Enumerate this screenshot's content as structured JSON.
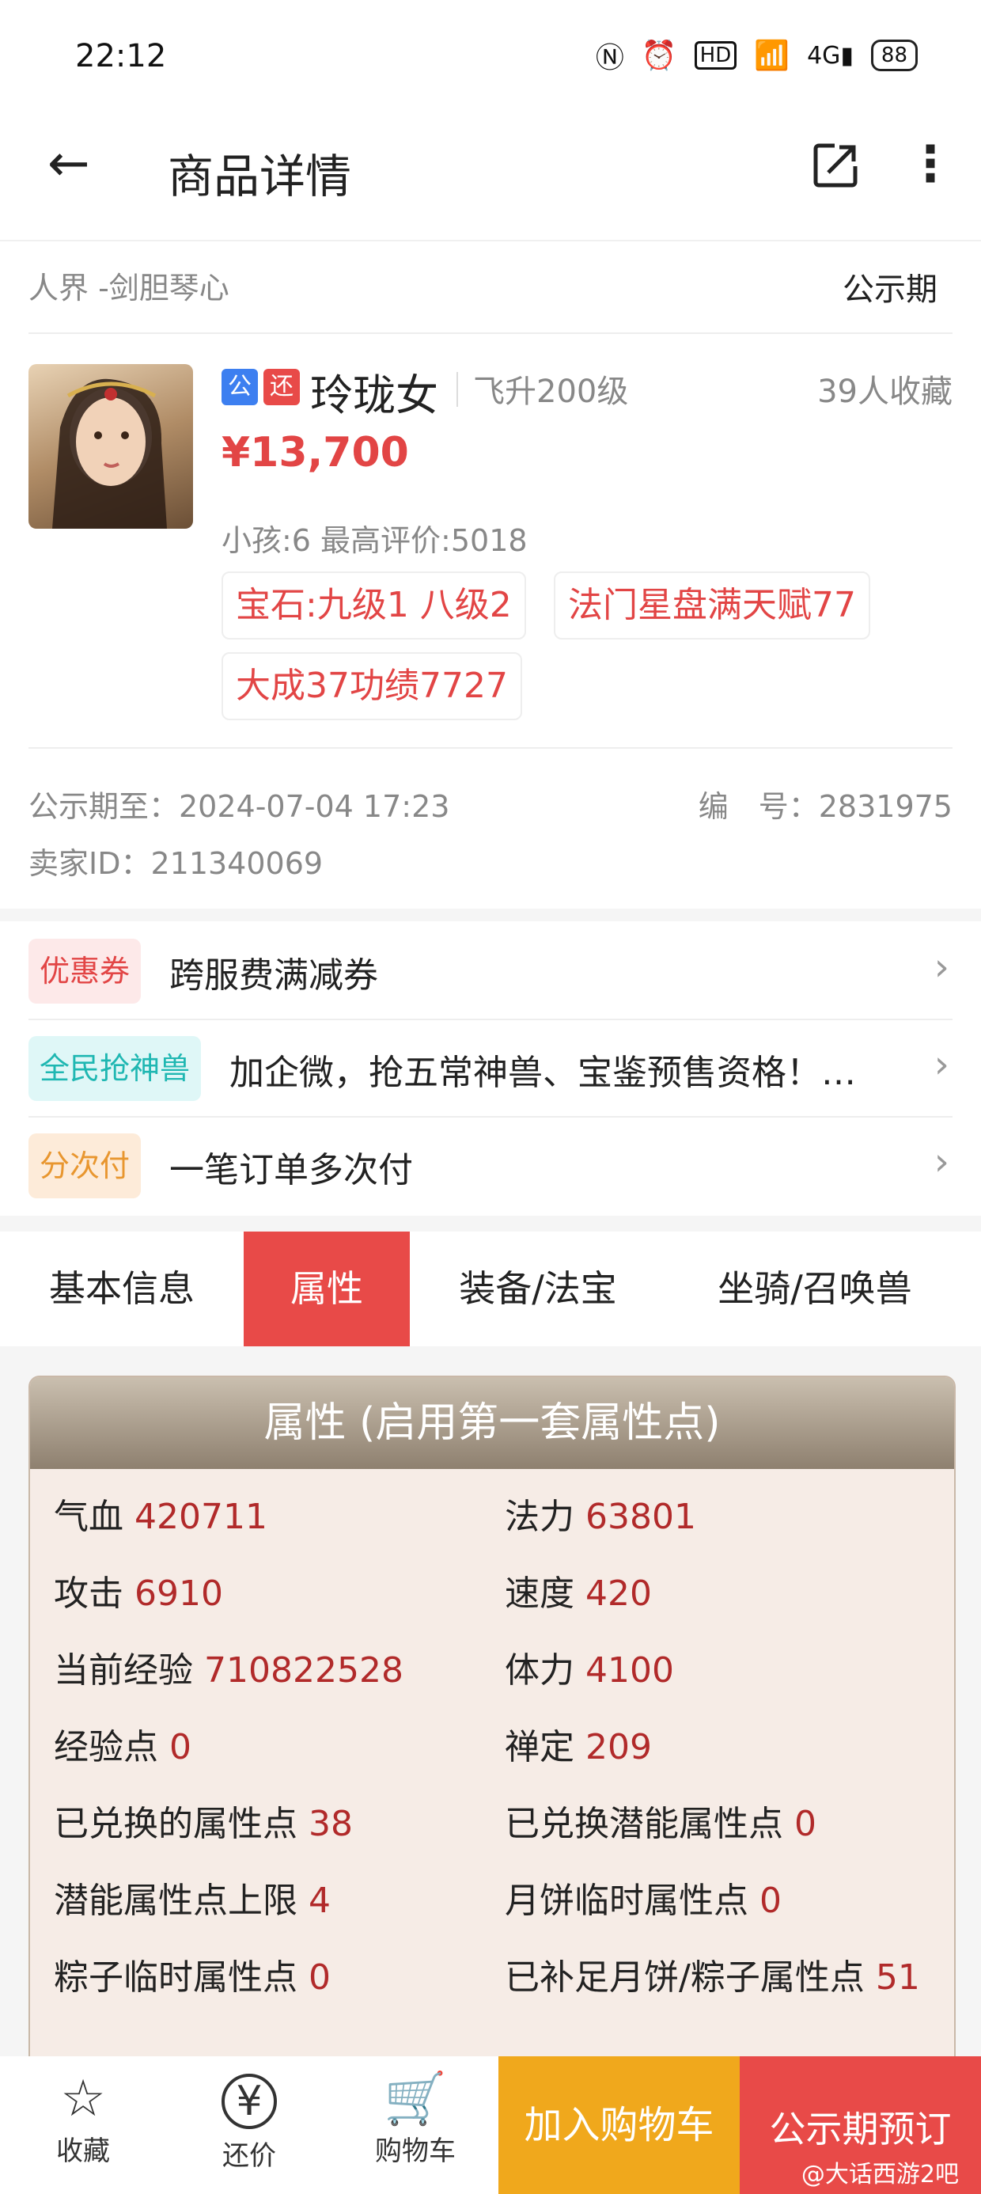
{
  "status_bar": {
    "time": "22:12",
    "battery": "88",
    "icons": [
      "nfc-icon",
      "alarm-icon",
      "hd-icon",
      "wifi-icon",
      "signal-4g-icon",
      "battery-icon"
    ]
  },
  "header": {
    "title": "商品详情"
  },
  "item": {
    "server": "人界 -剑胆琴心",
    "stage": "公示期",
    "badges": [
      "公",
      "还"
    ],
    "role": "玲珑女",
    "level": "飞升200级",
    "favorites": "39人收藏",
    "price": "¥13,700",
    "summary": "小孩:6 最高评价:5018",
    "tags": [
      "宝石:九级1 八级2",
      "法门星盘满天赋77",
      "大成37功绩7727"
    ],
    "period": "公示期至：2024-07-04 17:23",
    "serial": "编　号：2831975",
    "seller": "卖家ID：211340069"
  },
  "promos": [
    {
      "tag": "优惠券",
      "text": "跨服费满减券"
    },
    {
      "tag": "全民抢神兽",
      "text": "加企微，抢五常神兽、宝鉴预售资格！…"
    },
    {
      "tag": "分次付",
      "text": "一笔订单多次付"
    }
  ],
  "tabs": [
    "基本信息",
    "属性",
    "装备/法宝",
    "坐骑/召唤兽"
  ],
  "attributes": {
    "title": "属性 (启用第一套属性点)",
    "rows": [
      {
        "label": "气血",
        "value": "420711"
      },
      {
        "label": "法力",
        "value": "63801"
      },
      {
        "label": "攻击",
        "value": "6910"
      },
      {
        "label": "速度",
        "value": "420"
      },
      {
        "label": "当前经验",
        "value": "710822528"
      },
      {
        "label": "体力",
        "value": "4100"
      },
      {
        "label": "经验点",
        "value": "0"
      },
      {
        "label": "禅定",
        "value": "209"
      },
      {
        "label": "已兑换的属性点",
        "value": "38"
      },
      {
        "label": "已兑换潜能属性点",
        "value": "0"
      },
      {
        "label": "潜能属性点上限",
        "value": "4"
      },
      {
        "label": "月饼临时属性点",
        "value": "0"
      },
      {
        "label": "粽子临时属性点",
        "value": "0"
      },
      {
        "label": "已补足月饼/粽子属性点",
        "value": "51"
      }
    ]
  },
  "bottom_bar": {
    "favorite": "收藏",
    "bargain": "还价",
    "cart": "购物车",
    "add_to_cart": "加入购物车",
    "reserve": "公示期预订",
    "watermark": "@大话西游2吧"
  }
}
